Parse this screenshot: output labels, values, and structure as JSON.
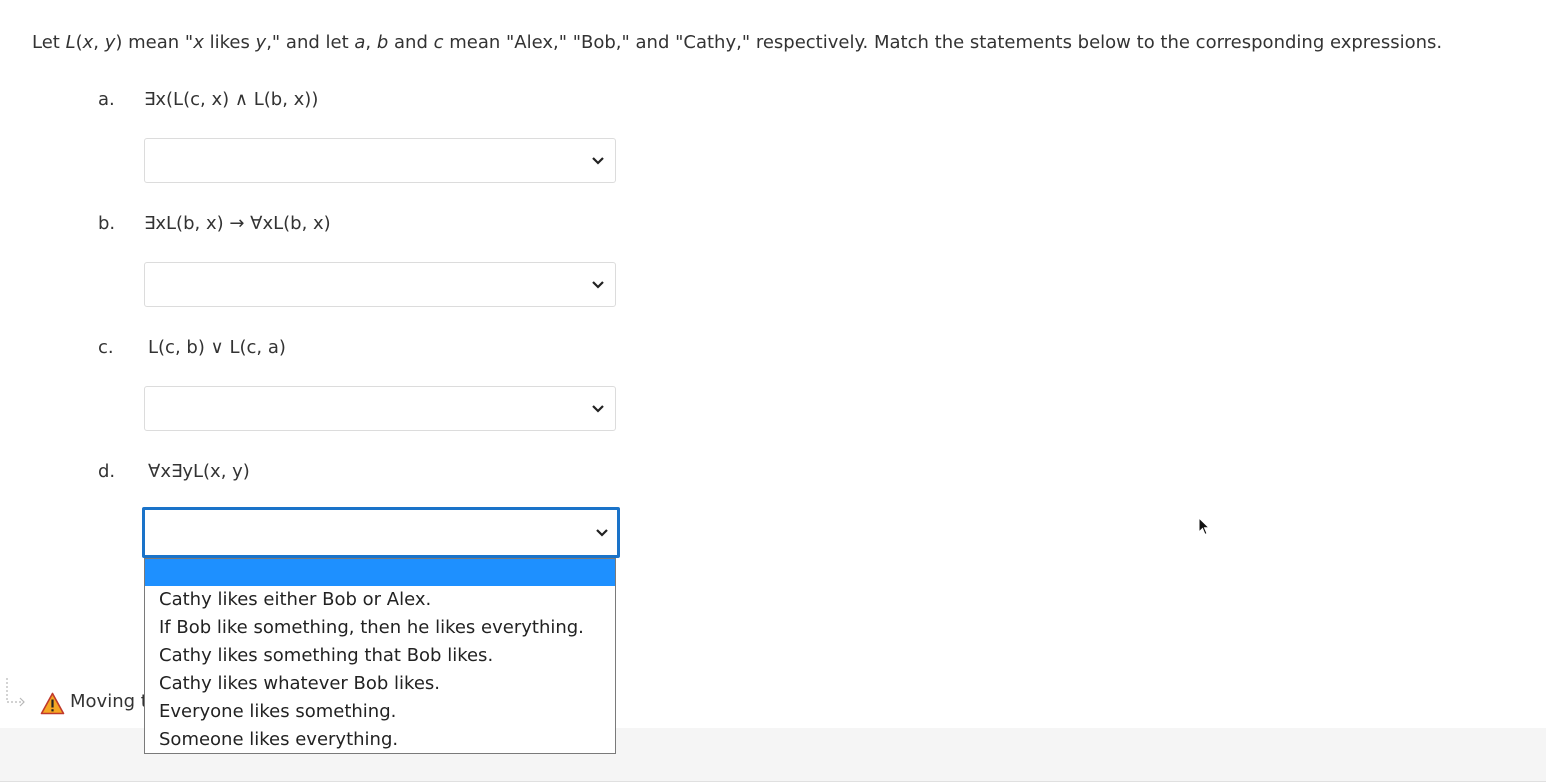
{
  "instructions": {
    "p1": "Let ",
    "L": "L",
    "p2": "(",
    "x1": "x",
    "p3": ", ",
    "y1": "y",
    "p4": ") mean \"",
    "x2": "x",
    "p5": " likes ",
    "y2": "y",
    "p6": ",\" and let ",
    "a": "a",
    "p7": ", ",
    "b": "b",
    "p8": " and ",
    "c": "c",
    "p9": " mean \"Alex,\" \"Bob,\" and \"Cathy,\" respectively.  Match the statements below to the corresponding expressions."
  },
  "questions": [
    {
      "letter": "a.",
      "expression": "∃x(L(c, x) ∧ L(b, x))",
      "selected": ""
    },
    {
      "letter": "b.",
      "expression": "∃xL(b, x) → ∀xL(b, x)",
      "selected": ""
    },
    {
      "letter": "c.",
      "expression": "L(c, b) ∨ L(c, a)",
      "selected": ""
    },
    {
      "letter": "d.",
      "expression": "∀x∃yL(x, y)",
      "selected": ""
    }
  ],
  "dropdown_options": [
    "",
    "Cathy likes either Bob or Alex.",
    "If Bob like something, then he likes everything.",
    "Cathy likes something that Bob likes.",
    "Cathy likes whatever Bob likes.",
    "Everyone likes something.",
    "Someone likes everything."
  ],
  "warning": {
    "text": "Moving t"
  },
  "colors": {
    "focus_border": "#1a73c9",
    "highlight": "#1e90ff",
    "warning_fill": "#f5a623"
  }
}
